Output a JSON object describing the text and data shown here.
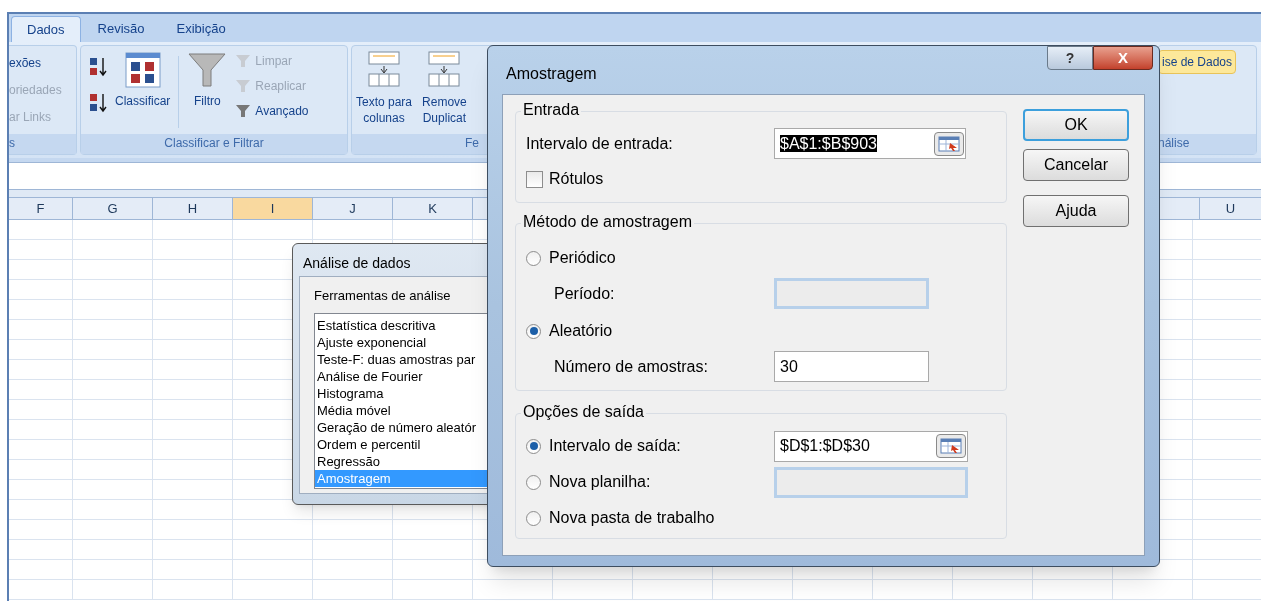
{
  "ribbon": {
    "tabs": [
      {
        "label": "Dados",
        "selected": true
      },
      {
        "label": "Revisão",
        "selected": false
      },
      {
        "label": "Exibição",
        "selected": false
      }
    ],
    "connections_group": {
      "label": "s",
      "items": [
        {
          "label": "exões",
          "disabled": false
        },
        {
          "label": "oriedades",
          "disabled": true
        },
        {
          "label": "ar Links",
          "disabled": true
        }
      ]
    },
    "sort_filter_group": {
      "label": "Classificar e Filtrar",
      "sort_button": "Classificar",
      "filter_button": "Filtro",
      "filter_items": [
        {
          "label": "Limpar",
          "disabled": true
        },
        {
          "label": "Reaplicar",
          "disabled": true
        },
        {
          "label": "Avançado",
          "disabled": false
        }
      ]
    },
    "data_tools_group": {
      "label": "Fe",
      "buttons": [
        {
          "lines": [
            "Texto para",
            "colunas"
          ]
        },
        {
          "lines": [
            "Remove",
            "Duplicat"
          ]
        }
      ]
    },
    "analysis_group": {
      "label": "nálise",
      "button": "ise de Dados"
    }
  },
  "column_headers_left": [
    {
      "label": "F",
      "selected": false
    },
    {
      "label": "G",
      "selected": false
    },
    {
      "label": "H",
      "selected": false
    },
    {
      "label": "I",
      "selected": true
    },
    {
      "label": "J",
      "selected": false
    },
    {
      "label": "K",
      "selected": false
    }
  ],
  "column_headers_right": [
    {
      "label": "U",
      "selected": false
    }
  ],
  "analysis_dialog": {
    "title": "Análise de dados",
    "group_label": "Ferramentas de análise",
    "tools": [
      {
        "label": "Estatística descritiva",
        "selected": false
      },
      {
        "label": "Ajuste exponencial",
        "selected": false
      },
      {
        "label": "Teste-F: duas amostras par",
        "selected": false
      },
      {
        "label": "Análise de Fourier",
        "selected": false
      },
      {
        "label": "Histograma",
        "selected": false
      },
      {
        "label": "Média móvel",
        "selected": false
      },
      {
        "label": "Geração de número aleatór",
        "selected": false
      },
      {
        "label": "Ordem e percentil",
        "selected": false
      },
      {
        "label": "Regressão",
        "selected": false
      },
      {
        "label": "Amostragem",
        "selected": true
      }
    ]
  },
  "sampling_dialog": {
    "title": "Amostragem",
    "help_button": "?",
    "close_button": "X",
    "input_section": {
      "label": "Entrada",
      "range_label": "Intervalo de entrada:",
      "range_value": "$A$1:$B$903",
      "range_text_selected": true,
      "labels_checkbox": {
        "label": "Rótulos",
        "checked": false
      }
    },
    "method_section": {
      "label": "Método de amostragem",
      "options": [
        {
          "label": "Periódico",
          "selected": false,
          "field_label": "Período:",
          "field_enabled": false
        },
        {
          "label": "Aleatório",
          "selected": true,
          "field_label": "Número de amostras:",
          "field_value": "30",
          "field_enabled": true
        }
      ]
    },
    "output_section": {
      "label": "Opções de saída",
      "options": [
        {
          "label": "Intervalo de saída:",
          "selected": true,
          "kind": "range",
          "field_value": "$D$1:$D$30",
          "field_enabled": true
        },
        {
          "label": "Nova planilha:",
          "selected": false,
          "kind": "field",
          "field_enabled": false
        },
        {
          "label": "Nova pasta de trabalho",
          "selected": false,
          "kind": "plain"
        }
      ]
    },
    "buttons": [
      {
        "label": "OK",
        "default": true
      },
      {
        "label": "Cancelar",
        "default": false
      },
      {
        "label": "Ajuda",
        "default": false
      }
    ]
  }
}
